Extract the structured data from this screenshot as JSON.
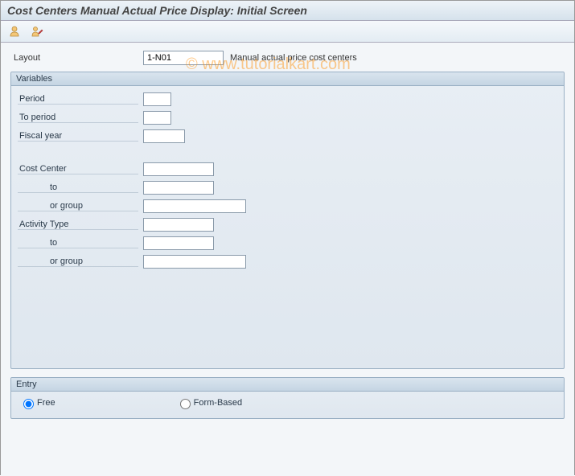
{
  "title": "Cost Centers Manual Actual Price Display: Initial Screen",
  "watermark": "© www.tutorialkart.com",
  "layout": {
    "label": "Layout",
    "value": "1-N01",
    "description": "Manual actual price cost centers"
  },
  "variables": {
    "header": "Variables",
    "period": {
      "label": "Period",
      "value": ""
    },
    "to_period": {
      "label": "To period",
      "value": ""
    },
    "fiscal_year": {
      "label": "Fiscal year",
      "value": ""
    },
    "cost_center": {
      "label": "Cost Center",
      "value": ""
    },
    "cost_center_to": {
      "label": "to",
      "value": ""
    },
    "cost_center_group": {
      "label": "or group",
      "value": ""
    },
    "activity_type": {
      "label": "Activity Type",
      "value": ""
    },
    "activity_type_to": {
      "label": "to",
      "value": ""
    },
    "activity_type_group": {
      "label": "or group",
      "value": ""
    }
  },
  "entry": {
    "header": "Entry",
    "free": {
      "label": "Free",
      "checked": true
    },
    "form": {
      "label": "Form-Based",
      "checked": false
    }
  }
}
